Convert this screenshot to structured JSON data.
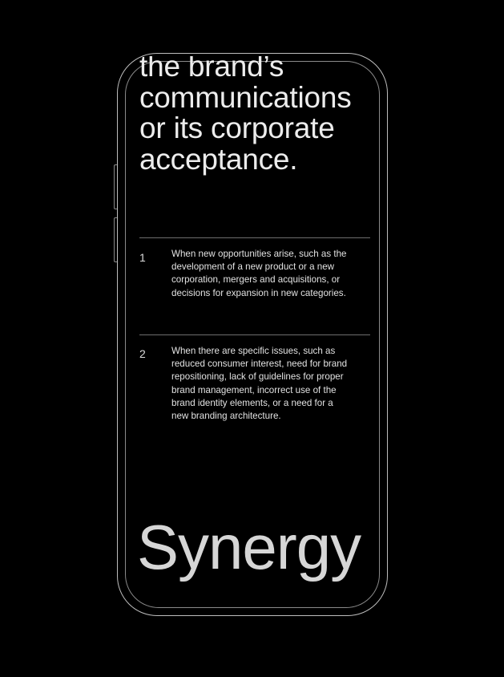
{
  "headline": {
    "lines": [
      "the brand’s",
      "communications",
      "or its corporate",
      "acceptance."
    ]
  },
  "items": [
    {
      "number": "1",
      "lines": [
        "When new opportunities arise, such as the",
        "development of a new product or a new",
        "corporation, mergers and acquisitions, or",
        "decisions for expansion in new categories."
      ]
    },
    {
      "number": "2",
      "lines": [
        "When there are specific issues, such as",
        "reduced consumer interest, need for brand",
        "repositioning, lack of guidelines for proper",
        "brand management, incorrect use of the",
        "brand identity elements, or a need for a",
        "new branding architecture."
      ]
    }
  ],
  "wordmark": "Synergy",
  "colors": {
    "background": "#000000",
    "text": "#e6e6e6",
    "frame": "#bdbdbd",
    "divider": "#6e6e6e"
  }
}
